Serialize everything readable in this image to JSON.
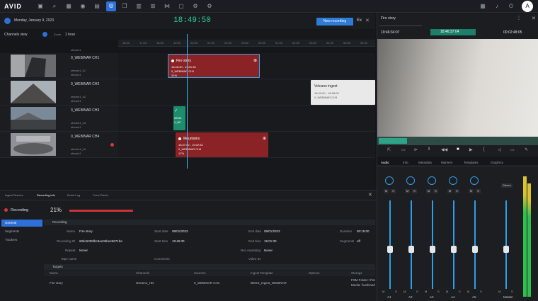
{
  "app": {
    "logo": "AVID"
  },
  "topbar": {
    "icons": [
      "folder-icon",
      "search-icon",
      "grid-icon",
      "eye-icon",
      "library-icon",
      "record-icon",
      "bookmark-icon",
      "layers-icon",
      "frame-icon",
      "share-icon",
      "edit-icon",
      "gear-icon",
      "settings-icon"
    ],
    "avatar": "A"
  },
  "schedule": {
    "date": "Monday, January 9, 2023",
    "timecode": "18:49:50",
    "new_recording": "New recording",
    "exit": "Ex",
    "view_mode": "Channels view",
    "zoom_label": "Zoom",
    "zoom_value": "1 hour",
    "ticks": [
      "16:00",
      "17:00",
      "18:00",
      "19:00",
      "20:00",
      "21:00",
      "22:00",
      "23:00",
      "00:00",
      "01:00",
      "02:00",
      "03:00",
      "04:00",
      "05:00",
      "06:00"
    ],
    "header_stream": "stream1",
    "channels": [
      {
        "name": "0_WEBINAR CH1",
        "sub1": "stream1_h1",
        "sub2": "stream1"
      },
      {
        "name": "0_WEBINAR CH2",
        "sub1": "stream1_h2",
        "sub2": "stream1"
      },
      {
        "name": "0_WEBINAR CH3",
        "sub1": "stream1_h3",
        "sub2": "stream1"
      },
      {
        "name": "0_WEBINAR CH4",
        "sub1": "stream1_h4",
        "sub2": "stream1"
      }
    ],
    "blocks": {
      "fire": {
        "title": "Fire story",
        "time": "18:46:30 - 19:01:30",
        "ch": "0_WEBINAR CH1",
        "pct": "21%"
      },
      "volcano": {
        "title": "Volcano ingest",
        "time": "18:20:00 - 18:35:00",
        "ch": "0_WEBINAR CH3"
      },
      "green": {
        "l1": "NEWS",
        "l2": "0_WE"
      },
      "mountains": {
        "title": "Mountains",
        "time": "18:47:52 - 19:02:52",
        "ch": "0_WEBINAR CH4",
        "pct": "17%"
      }
    }
  },
  "panel": {
    "tabs": [
      "Ingest Servers",
      "Recording info",
      "Event Log",
      "Crew Points"
    ],
    "status": "Recording",
    "percent": "21%",
    "side": [
      "General",
      "Segments",
      "Trackers"
    ],
    "section_recording": "Recording",
    "fields": {
      "name_l": "Name",
      "name_v": "Fire story",
      "start_date_l": "Start date",
      "start_date_v": "09/01/2023",
      "end_date_l": "End date",
      "end_date_v": "09/01/2023",
      "duration_l": "Duration",
      "duration_v": "00:15:00",
      "recid_l": "Recording ID",
      "recid_v": "60bc6305fbc9ee06be46671ba",
      "start_time_l": "Start time",
      "start_time_v": "18:46:30",
      "end_time_l": "End time",
      "end_time_v": "15:01:30",
      "segments_l": "Segments",
      "segments_v": "off",
      "repeat_l": "Repeat",
      "repeat_v": "Never",
      "rec_repeating_l": "Rec repeating",
      "rec_repeating_v": "Never",
      "tape_l": "Tape name",
      "comments_l": "Comments",
      "video_l": "Video ID"
    },
    "section_targets": "Targets",
    "targets_headers": [
      "Name",
      "Channels",
      "Sources",
      "Ingest Template",
      "Options",
      "Storage"
    ],
    "targets_row": [
      "Fire story",
      "stream1_HD",
      "0_WEBINAR CH1",
      "BEGS_Ingest_WEBINAR",
      "",
      "FSM Folder: /Fire"
    ],
    "storage_line2": "Media: \\\\webinar\\fire"
  },
  "monitor": {
    "title": "Fire story",
    "tc_left": "19:46:34:07",
    "tc_mid": "18:46:37:04",
    "tc_right": "00:02:48:05",
    "tabs": [
      "Audio",
      "Info",
      "Metadata",
      "Markers",
      "Templates",
      "Graphics"
    ],
    "channels": [
      "A1",
      "A2",
      "A3",
      "A4",
      "A5",
      "Master"
    ],
    "stereo": "Stereo",
    "mute": "M",
    "solo": "S",
    "mark_m": "M",
    "mark_s": "S",
    "mark_mn": "M4",
    "levels": [
      0.45,
      0.45,
      0.45,
      0.45,
      0.45,
      0.45
    ]
  }
}
